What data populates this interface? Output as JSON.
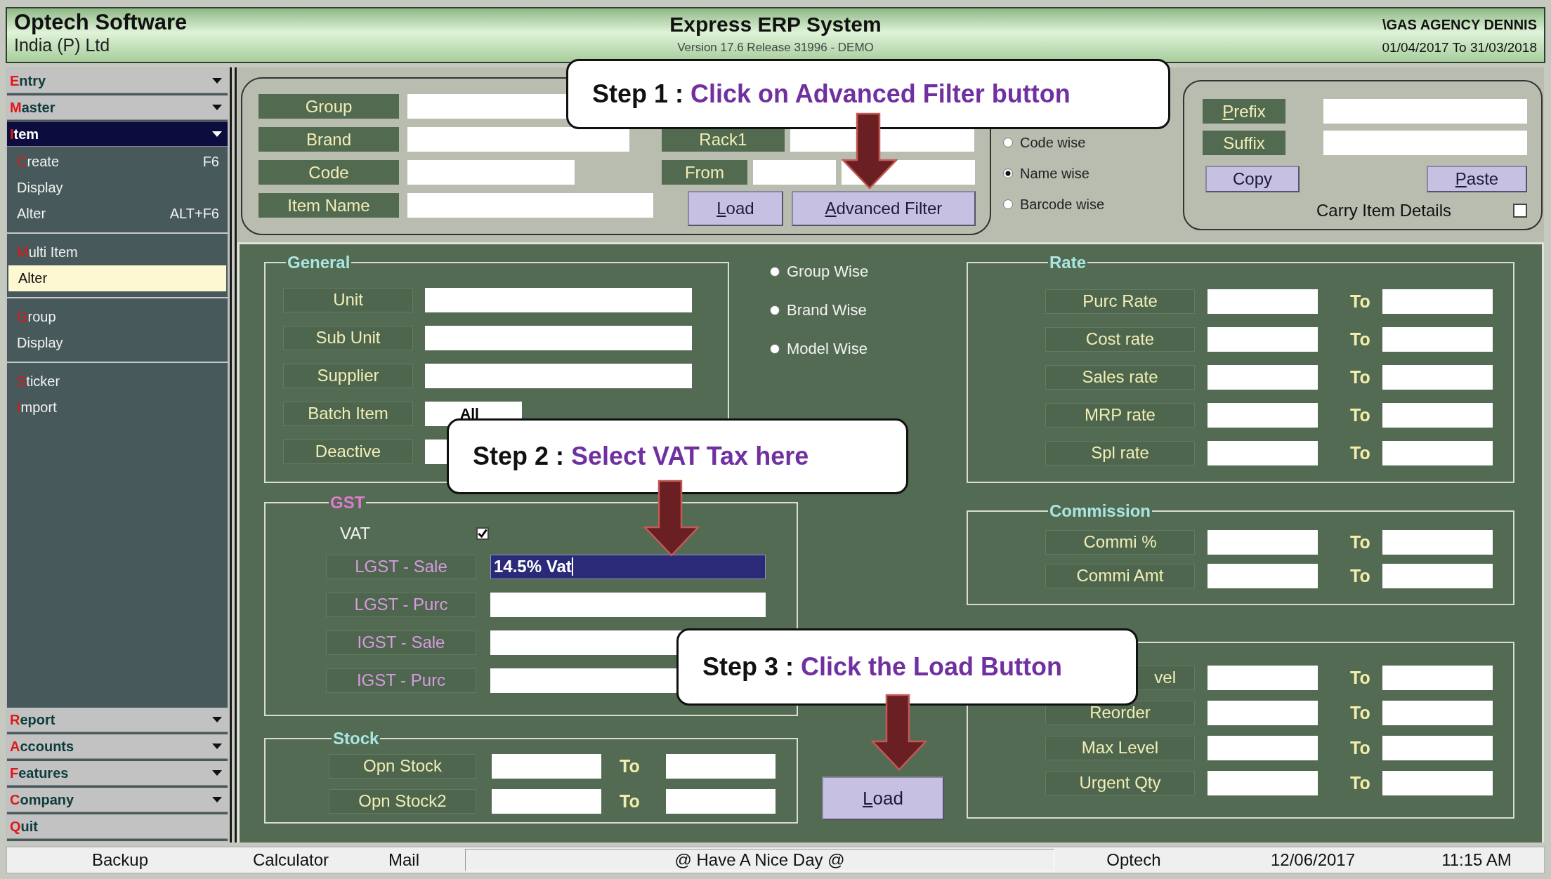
{
  "header": {
    "company": "Optech Software",
    "company_sub": "India (P) Ltd",
    "title": "Express ERP System",
    "version": "Version 17.6 Release 31996 - DEMO",
    "client": "\\GAS AGENCY DENNIS",
    "period": "01/04/2017 To 31/03/2018"
  },
  "sidebar": {
    "top_menus": [
      {
        "label": "Entry",
        "selected": false,
        "submenu": true
      },
      {
        "label": "Master",
        "selected": false,
        "submenu": true
      },
      {
        "label": "Item",
        "selected": true,
        "submenu": true
      }
    ],
    "item_groups": [
      {
        "items": [
          {
            "label": "Create",
            "shortcut": "F6",
            "hotkey": true,
            "selected": false
          },
          {
            "label": "Display",
            "hotkey": false,
            "selected": false
          },
          {
            "label": "Alter",
            "shortcut": "ALT+F6",
            "hotkey": false,
            "selected": false
          }
        ]
      },
      {
        "items": [
          {
            "label": "Multi Item",
            "hotkey": true,
            "selected": false
          },
          {
            "label": "Alter",
            "hotkey": false,
            "selected": true
          }
        ]
      },
      {
        "items": [
          {
            "label": "Group",
            "hotkey": true,
            "selected": false
          },
          {
            "label": "Display",
            "hotkey": false,
            "selected": false
          }
        ]
      },
      {
        "items": [
          {
            "label": "Sticker",
            "hotkey": true,
            "selected": false
          },
          {
            "label": "Import",
            "hotkey": true,
            "selected": false
          }
        ]
      }
    ],
    "bottom_menus": [
      {
        "label": "Report",
        "selected": false,
        "submenu": true
      },
      {
        "label": "Accounts",
        "selected": false,
        "submenu": true
      },
      {
        "label": "Features",
        "selected": false,
        "submenu": true
      },
      {
        "label": "Company",
        "selected": false,
        "submenu": true
      },
      {
        "label": "Quit",
        "selected": false,
        "submenu": false
      }
    ]
  },
  "filter": {
    "fields": [
      {
        "label": "Group"
      },
      {
        "label": "Brand"
      },
      {
        "label": "Code"
      },
      {
        "label": "Item Name"
      }
    ],
    "range_fields": [
      {
        "label": "Rack1"
      },
      {
        "label": "From"
      }
    ],
    "buttons": [
      {
        "label": "Load",
        "underline_first": true
      },
      {
        "label": "Advanced Filter",
        "underline_first": true
      }
    ]
  },
  "sort_options": [
    {
      "label": "Code wise",
      "selected": false
    },
    {
      "label": "Name wise",
      "selected": true
    },
    {
      "label": "Barcode wise",
      "selected": false
    }
  ],
  "prefix_suffix": {
    "fields": [
      {
        "label": "Prefix",
        "underline_first": true
      },
      {
        "label": "Suffix",
        "underline_first": false
      }
    ],
    "buttons": [
      {
        "label": "Copy",
        "underline_first": false
      },
      {
        "label": "Paste",
        "underline_first": true
      }
    ],
    "carry": {
      "label": "Carry Item Details",
      "checked": false
    }
  },
  "general": {
    "title": "General",
    "fields": [
      {
        "label": "Unit"
      },
      {
        "label": "Sub Unit"
      },
      {
        "label": "Supplier"
      },
      {
        "label": "Batch Item",
        "value": "All"
      },
      {
        "label": "Deactive"
      }
    ]
  },
  "group_options": [
    {
      "label": "Group Wise",
      "selected": false
    },
    {
      "label": "Brand Wise",
      "selected": false
    },
    {
      "label": "Model Wise",
      "selected": false
    }
  ],
  "gst": {
    "title": "GST",
    "vat": {
      "label": "VAT",
      "checked": true
    },
    "fields": [
      {
        "label": "LGST - Sale",
        "value": "14.5% Vat",
        "focused": true
      },
      {
        "label": "LGST - Purc",
        "focused": false
      },
      {
        "label": "IGST - Sale",
        "focused": false
      },
      {
        "label": "IGST - Purc",
        "focused": false
      }
    ]
  },
  "stock": {
    "title": "Stock",
    "rows": [
      {
        "label": "Opn Stock",
        "to": "To"
      },
      {
        "label": "Opn Stock2",
        "to": "To"
      }
    ]
  },
  "rate": {
    "title": "Rate",
    "rows": [
      {
        "label": "Purc Rate",
        "to": "To"
      },
      {
        "label": "Cost rate",
        "to": "To"
      },
      {
        "label": "Sales rate",
        "to": "To"
      },
      {
        "label": "MRP rate",
        "to": "To"
      },
      {
        "label": "Spl rate",
        "to": "To"
      }
    ]
  },
  "commission": {
    "title": "Commission",
    "rows": [
      {
        "label": "Commi %",
        "to": "To"
      },
      {
        "label": "Commi Amt",
        "to": "To"
      }
    ]
  },
  "levels": {
    "rows": [
      {
        "label": "vel",
        "to": "To"
      },
      {
        "label": "Reorder",
        "to": "To"
      },
      {
        "label": "Max Level",
        "to": "To"
      },
      {
        "label": "Urgent Qty",
        "to": "To"
      }
    ]
  },
  "load_button": {
    "label": "Load",
    "underline_first": true
  },
  "callouts": [
    {
      "step": "Step 1 :",
      "text": "Click on Advanced Filter button"
    },
    {
      "step": "Step 2 :",
      "text": "Select VAT Tax here"
    },
    {
      "step": "Step 3 :",
      "text": "Click the Load Button"
    }
  ],
  "status_bar": [
    "Backup",
    "Calculator",
    "Mail",
    "@ Have A Nice Day @",
    "Optech",
    "12/06/2017",
    "11:15 AM"
  ]
}
